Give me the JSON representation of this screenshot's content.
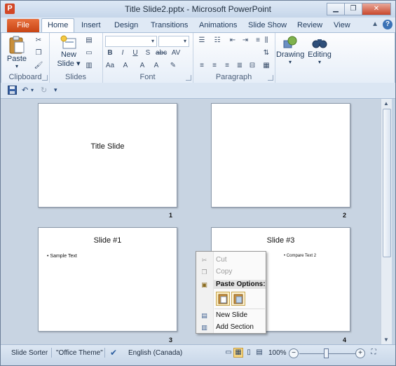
{
  "window": {
    "title": "Title Slide2.pptx - Microsoft PowerPoint",
    "app_icon_letter": "P",
    "controls": [
      "minimize",
      "maximize",
      "close"
    ]
  },
  "ribbon": {
    "tabs": [
      {
        "label": "File"
      },
      {
        "label": "Home"
      },
      {
        "label": "Insert"
      },
      {
        "label": "Design"
      },
      {
        "label": "Transitions"
      },
      {
        "label": "Animations"
      },
      {
        "label": "Slide Show"
      },
      {
        "label": "Review"
      },
      {
        "label": "View"
      }
    ],
    "active_tab": "Home",
    "groups": {
      "clipboard": {
        "label": "Clipboard",
        "paste_label": "Paste"
      },
      "slides": {
        "label": "Slides",
        "new_slide_label_1": "New",
        "new_slide_label_2": "Slide"
      },
      "font": {
        "label": "Font"
      },
      "paragraph": {
        "label": "Paragraph"
      },
      "drawing": {
        "label": "Drawing"
      },
      "editing": {
        "label": "Editing"
      }
    }
  },
  "slides": [
    {
      "number": "1",
      "title": "Title Slide",
      "bullets": []
    },
    {
      "number": "2",
      "title": "",
      "bullets": []
    },
    {
      "number": "3",
      "title": "Slide #1",
      "bullets": [
        "Sample Text"
      ]
    },
    {
      "number": "4",
      "title": "Slide #3",
      "bullets": [
        "Compare Text 2"
      ]
    }
  ],
  "context_menu": {
    "items": {
      "cut": "Cut",
      "copy": "Copy",
      "paste_options": "Paste Options:",
      "new_slide": "New Slide",
      "add_section": "Add Section"
    }
  },
  "status_bar": {
    "view_name": "Slide Sorter",
    "theme": "\"Office Theme\"",
    "language": "English (Canada)",
    "zoom": "100%"
  },
  "colors": {
    "file_tab": "#d24726",
    "ribbon_bg": "#f4f7fb",
    "sorter_bg": "#c8d4e2"
  }
}
